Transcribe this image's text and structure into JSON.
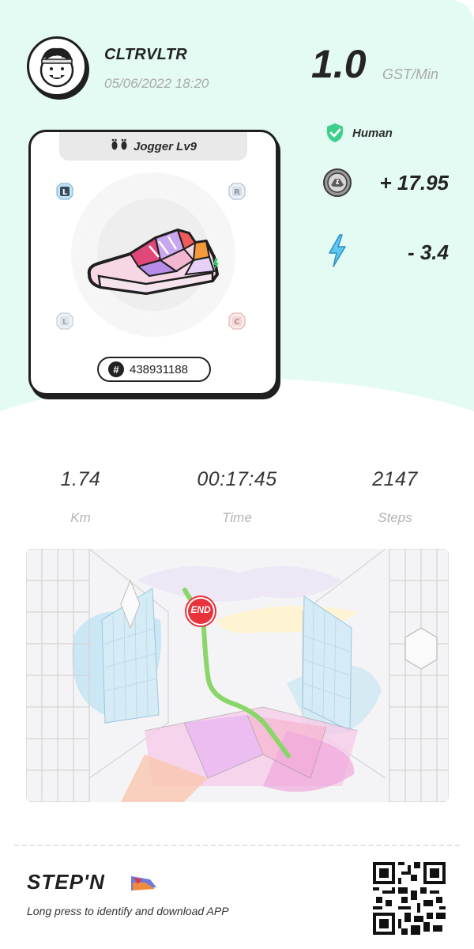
{
  "profile": {
    "username": "CLTRVLTR",
    "datetime": "05/06/2022 18:20",
    "avatar_icon": "cartoon-face-avatar"
  },
  "rate": {
    "value": "1.0",
    "unit": "GST/Min"
  },
  "sneaker": {
    "type_label": "Jogger Lv9",
    "type_icon": "footprints-icon",
    "serial": "438931188",
    "serial_icon": "hash-icon",
    "gem_slots": [
      "L",
      "R",
      "L",
      "C"
    ]
  },
  "status": {
    "verification_label": "Human",
    "verification_icon": "shield-check-icon",
    "gst_earned": "+ 17.95",
    "gst_icon": "gst-coin-icon",
    "energy_used": "- 3.4",
    "energy_icon": "lightning-icon"
  },
  "stats": {
    "distance": {
      "value": "1.74",
      "label": "Km"
    },
    "time": {
      "value": "00:17:45",
      "label": "Time"
    },
    "steps": {
      "value": "2147",
      "label": "Steps"
    }
  },
  "map": {
    "end_label": "END",
    "route_color": "#8ad66a"
  },
  "footer": {
    "brand": "STEP'N",
    "tagline": "Long press to identify and download APP"
  },
  "colors": {
    "header_bg": "#e3fbf2",
    "accent_green": "#3ccf8e",
    "end_red": "#e8323c"
  }
}
